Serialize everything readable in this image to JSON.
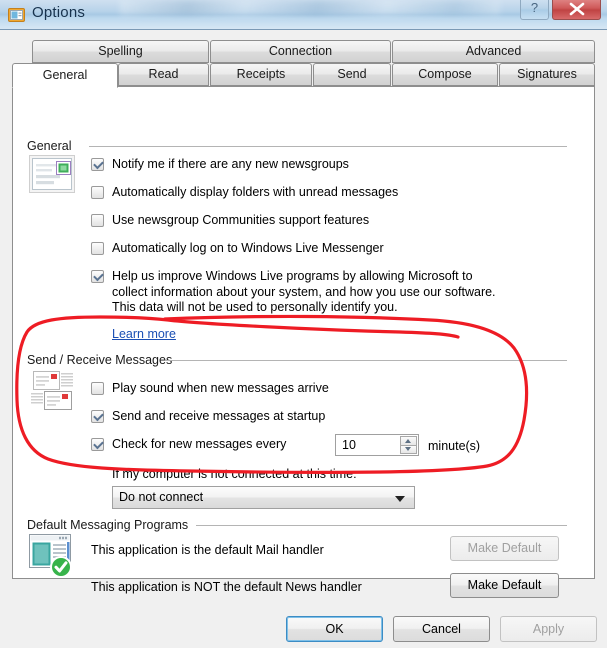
{
  "window": {
    "title": "Options",
    "icon": "options-window-icon",
    "help_button": "?",
    "close_button": "×"
  },
  "tabs": {
    "row1": [
      {
        "label": "Spelling",
        "active": false
      },
      {
        "label": "Connection",
        "active": false
      },
      {
        "label": "Advanced",
        "active": false
      }
    ],
    "row2": [
      {
        "label": "General",
        "active": true
      },
      {
        "label": "Read",
        "active": false
      },
      {
        "label": "Receipts",
        "active": false
      },
      {
        "label": "Send",
        "active": false
      },
      {
        "label": "Compose",
        "active": false
      },
      {
        "label": "Signatures",
        "active": false
      }
    ]
  },
  "general_group": {
    "label": "General",
    "icon": "newsgroup-icon",
    "options": [
      {
        "label": "Notify me if there are any new newsgroups",
        "checked": true
      },
      {
        "label": "Automatically display folders with unread messages",
        "checked": false
      },
      {
        "label": "Use newsgroup Communities support features",
        "checked": false
      },
      {
        "label": "Automatically log on to Windows Live Messenger",
        "checked": false
      }
    ],
    "improve": {
      "checked": true,
      "line1": "Help us improve Windows Live programs by allowing Microsoft to",
      "line2": "collect information about your system, and how you use our software.",
      "line3": "This data will not be used to personally identify you."
    },
    "learn_more": "Learn more"
  },
  "send_receive_group": {
    "label": "Send / Receive Messages",
    "icon": "envelopes-icon",
    "options": [
      {
        "label": "Play sound when new messages arrive",
        "checked": false
      },
      {
        "label": "Send and receive messages at startup",
        "checked": true
      },
      {
        "label": "Check for new messages every",
        "checked": true
      }
    ],
    "interval": {
      "value": "10",
      "unit": "minute(s)"
    },
    "not_connected_label": "If my computer is not connected at this time:",
    "connect_combo": {
      "value": "Do not connect"
    }
  },
  "default_programs_group": {
    "label": "Default Messaging Programs",
    "icon": "default-app-icon",
    "rows": [
      {
        "text": "This application is the default Mail handler",
        "button": "Make Default",
        "disabled": true
      },
      {
        "text": "This application is NOT the default News handler",
        "button": "Make Default",
        "disabled": false
      }
    ]
  },
  "dialog_buttons": {
    "ok": {
      "label": "OK",
      "disabled": false,
      "focused": true
    },
    "cancel": {
      "label": "Cancel",
      "disabled": false,
      "focused": false
    },
    "apply": {
      "label": "Apply",
      "disabled": true,
      "focused": false
    }
  },
  "annotation": {
    "type": "hand-drawn-ellipse",
    "color": "#ee1c24",
    "target": "Send / Receive Messages section"
  }
}
